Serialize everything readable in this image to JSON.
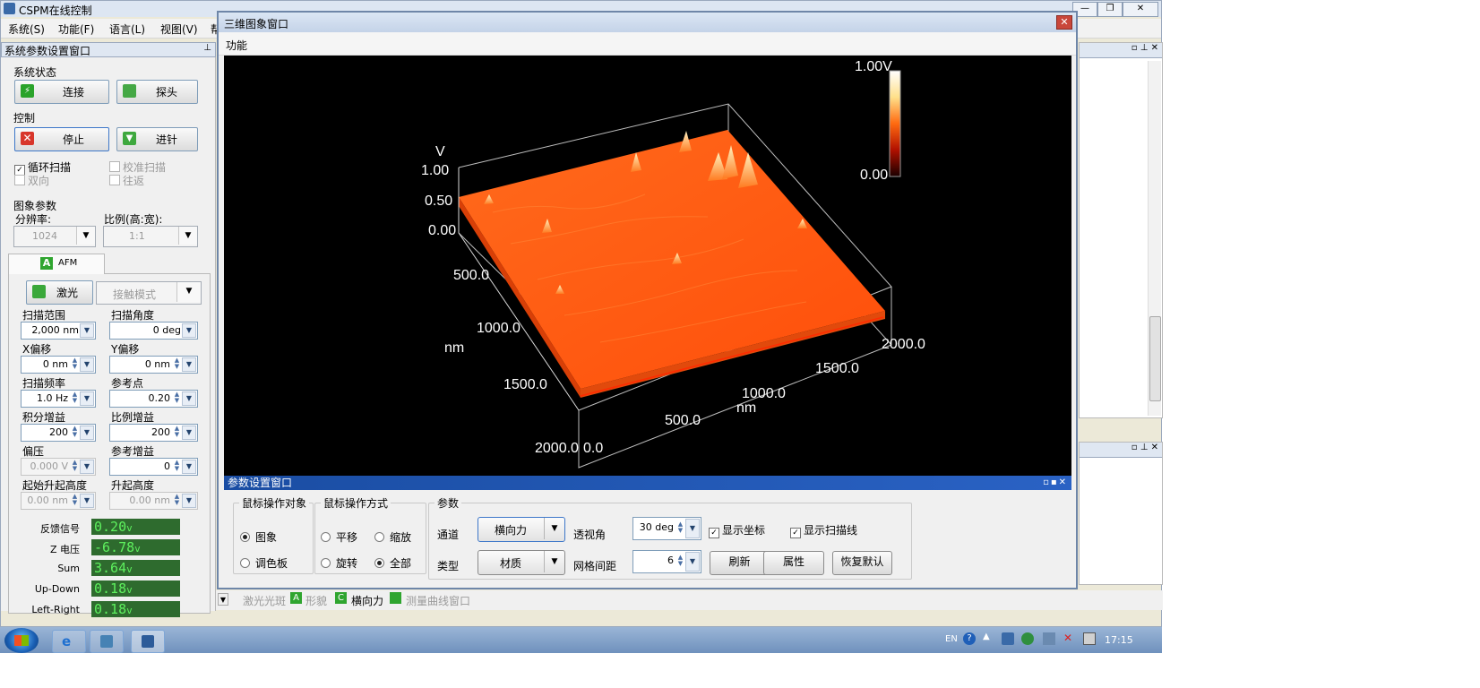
{
  "main": {
    "title": "CSPM在线控制",
    "menus": [
      "系统(S)",
      "功能(F)",
      "语言(L)",
      "视图(V)",
      "帮"
    ],
    "window_buttons": [
      "—",
      "❐",
      "✕"
    ]
  },
  "left": {
    "title": "系统参数设置窗口",
    "status_group": "系统状态",
    "connect_label": "连接",
    "probe_label": "探头",
    "control_group": "控制",
    "stop_label": "停止",
    "approach_label": "进针",
    "loop_scan": "循环扫描",
    "calib_scan": "校准扫描",
    "bidir": "双向",
    "round_trip": "往返",
    "image_group": "图象参数",
    "resolution_label": "分辨率:",
    "resolution_value": "1024",
    "ratio_label": "比例(高:宽):",
    "ratio_value": "1:1",
    "afm_tab": "AFM",
    "laser_label": "激光",
    "mode_value": "接触模式",
    "params": [
      {
        "label": "扫描范围",
        "value": "2,000 nm",
        "kind": "combo"
      },
      {
        "label": "扫描角度",
        "value": "0 deg",
        "kind": "combo"
      },
      {
        "label": "X偏移",
        "value": "0 nm",
        "kind": "spin"
      },
      {
        "label": "Y偏移",
        "value": "0 nm",
        "kind": "spin"
      },
      {
        "label": "扫描频率",
        "value": "1.0 Hz",
        "kind": "spin"
      },
      {
        "label": "参考点",
        "value": "0.20",
        "kind": "spin"
      },
      {
        "label": "积分增益",
        "value": "200",
        "kind": "spin"
      },
      {
        "label": "比例增益",
        "value": "200",
        "kind": "spin"
      },
      {
        "label": "偏压",
        "value": "0.000 V",
        "kind": "spin",
        "disabled": true
      },
      {
        "label": "参考增益",
        "value": "0",
        "kind": "spin"
      },
      {
        "label": "起始升起高度",
        "value": "0.00 nm",
        "kind": "spin",
        "disabled": true
      },
      {
        "label": "升起高度",
        "value": "0.00 nm",
        "kind": "spin",
        "disabled": true
      }
    ],
    "readouts": [
      {
        "label": "反馈信号",
        "value": "0.20",
        "unit": "v"
      },
      {
        "label": "Z 电压",
        "value": "-6.78",
        "unit": "v"
      },
      {
        "label": "Sum",
        "value": "3.64",
        "unit": "v"
      },
      {
        "label": "Up-Down",
        "value": "0.18",
        "unit": "v"
      },
      {
        "label": "Left-Right",
        "value": "0.18",
        "unit": "v"
      }
    ]
  },
  "win3d": {
    "title": "三维图象窗口",
    "menu": "功能",
    "close": "✕",
    "colorbar_max": "1.00V",
    "colorbar_min": "0.00",
    "z_unit": "V",
    "z_ticks": [
      "1.00",
      "0.50",
      "0.00"
    ],
    "left_axis_ticks": [
      "500.0",
      "1000.0",
      "1500.0",
      "2000.0"
    ],
    "left_axis_unit": "nm",
    "bottom_axis_ticks": [
      "0.0",
      "500.0",
      "1000.0",
      "1500.0",
      "2000.0"
    ],
    "bottom_axis_unit": "nm",
    "colors": {
      "surface": "#ff5a12",
      "surface_edge": "#d23a05",
      "peak": "#ffd27a"
    }
  },
  "params": {
    "title": "参数设置窗口",
    "mouse_target_group": "鼠标操作对象",
    "target_image": "图象",
    "target_palette": "调色板",
    "mouse_mode_group": "鼠标操作方式",
    "mode_pan": "平移",
    "mode_zoom": "缩放",
    "mode_rotate": "旋转",
    "mode_all": "全部",
    "param_group": "参数",
    "channel_label": "通道",
    "channel_value": "横向力",
    "type_label": "类型",
    "type_value": "材质",
    "view_angle_label": "透视角",
    "view_angle_value": "30 deg",
    "grid_spacing_label": "网格间距",
    "grid_spacing_value": "6",
    "show_axes": "显示坐标",
    "show_scanline": "显示扫描线",
    "refresh": "刷新",
    "properties": "属性",
    "restore_default": "恢复默认"
  },
  "tabs": {
    "laser_spot": "激光光斑",
    "topography": "形貌",
    "lateral": "横向力",
    "curve": "测量曲线窗口"
  },
  "taskbar": {
    "lang": "EN",
    "time": "17:15"
  }
}
